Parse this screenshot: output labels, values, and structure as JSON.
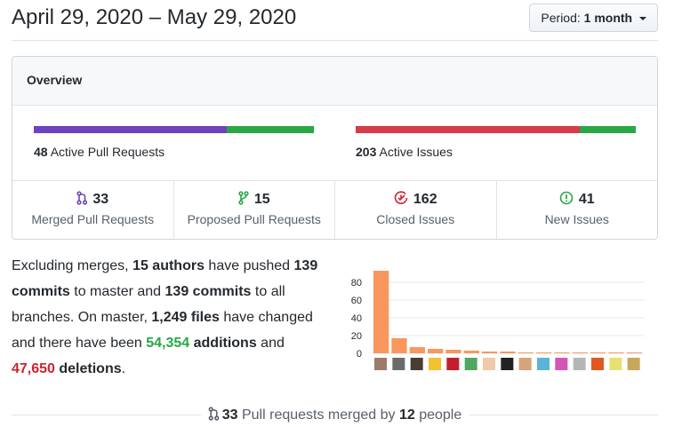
{
  "header": {
    "date_range": "April 29, 2020 – May 29, 2020",
    "period_label": "Period:",
    "period_value": "1 month"
  },
  "overview": {
    "title": "Overview",
    "pull_requests": {
      "count": "48",
      "label": "Active Pull Requests",
      "merged_fraction": 0.69,
      "colors": [
        "#6f42c1",
        "#28a745"
      ]
    },
    "issues": {
      "count": "203",
      "label": "Active Issues",
      "closed_fraction": 0.8,
      "colors": [
        "#d73a49",
        "#28a745"
      ]
    },
    "stats": [
      {
        "icon": "merged-pr-icon",
        "color": "#6f42c1",
        "count": "33",
        "label": "Merged Pull Requests"
      },
      {
        "icon": "open-pr-icon",
        "color": "#28a745",
        "count": "15",
        "label": "Proposed Pull Requests"
      },
      {
        "icon": "closed-issue-icon",
        "color": "#cb2431",
        "count": "162",
        "label": "Closed Issues"
      },
      {
        "icon": "new-issue-icon",
        "color": "#28a745",
        "count": "41",
        "label": "New Issues"
      }
    ]
  },
  "summary": {
    "t1": "Excluding merges, ",
    "authors": "15 authors",
    "t2": " have pushed ",
    "commits_master": "139 commits",
    "t3": " to master and ",
    "commits_all": "139 commits",
    "t4": " to all branches. On master, ",
    "files": "1,249 files",
    "t5": " have changed and there have been ",
    "additions_num": "54,354",
    "additions_word": " additions",
    "t6": " and ",
    "deletions_num": "47,650",
    "deletions_word": " deletions",
    "t7": "."
  },
  "chart_data": {
    "type": "bar",
    "color": "#f9975d",
    "yticks": [
      "0",
      "20",
      "40",
      "60",
      "80"
    ],
    "ylim": [
      0,
      100
    ],
    "values": [
      93,
      17,
      7,
      5,
      4,
      3,
      2,
      2,
      1,
      1,
      1,
      1,
      1,
      1,
      1
    ],
    "avatars": [
      "#9e7a6a",
      "#6b6b6b",
      "#4a3b33",
      "#f2c230",
      "#c41e2a",
      "#4fa85f",
      "#f0c9a8",
      "#222222",
      "#d9a27a",
      "#5bb3d8",
      "#d455b5",
      "#b5b5b5",
      "#e0581f",
      "#e8e070",
      "#c9a75a"
    ]
  },
  "footer": {
    "count": "33",
    "text1": " Pull requests merged by ",
    "people": "12",
    "text2": " people"
  }
}
